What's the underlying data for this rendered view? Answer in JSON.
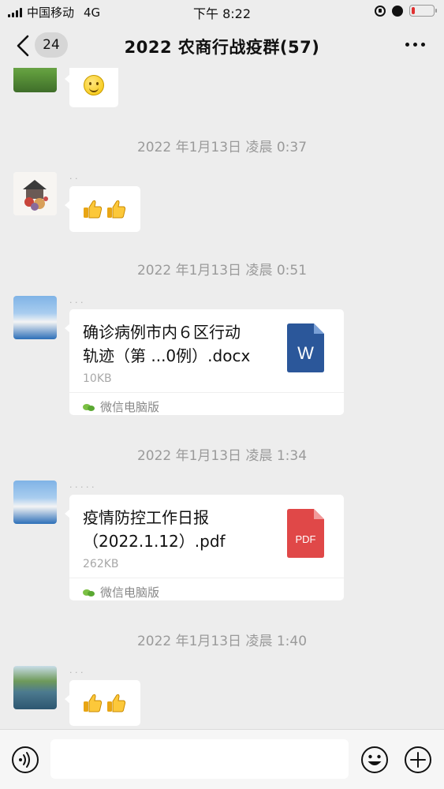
{
  "status_bar": {
    "carrier": "中国移动",
    "network": "4G",
    "time": "下午 8:22",
    "battery_level": 0.15,
    "battery_color": "#e03131"
  },
  "nav": {
    "back_icon": "chevron-left-icon",
    "unread_count": "24",
    "title": "2022 农商行战疫群(57)",
    "more_icon": "more-dots-icon"
  },
  "messages": [
    {
      "kind": "emoji",
      "emoji": "smile-icon"
    },
    {
      "kind": "timestamp",
      "text": "2022 年1月13日 凌晨 0:37"
    },
    {
      "kind": "emoji",
      "emoji": "thumbs-up-icon x2"
    },
    {
      "kind": "timestamp",
      "text": "2022 年1月13日 凌晨 0:51"
    },
    {
      "kind": "file",
      "title_line1": "确诊病例市内６区行动",
      "title_line2": "轨迹（第 ...0例）.docx",
      "size": "10KB",
      "source": "微信电脑版",
      "file_icon_label": "W",
      "file_icon_color": "#2b579a"
    },
    {
      "kind": "timestamp",
      "text": "2022 年1月13日 凌晨 1:34"
    },
    {
      "kind": "file",
      "title_line1": "疫情防控工作日报",
      "title_line2": "（2022.1.12）.pdf",
      "size": "262KB",
      "source": "微信电脑版",
      "file_icon_label": "PDF",
      "file_icon_color": "#e04848"
    },
    {
      "kind": "timestamp",
      "text": "2022 年1月13日 凌晨 1:40"
    },
    {
      "kind": "emoji",
      "emoji": "thumbs-up-icon x2"
    }
  ],
  "input_bar": {
    "voice_icon": "voice-icon",
    "placeholder": "",
    "emoji_icon": "emoji-icon",
    "plus_icon": "plus-icon"
  }
}
